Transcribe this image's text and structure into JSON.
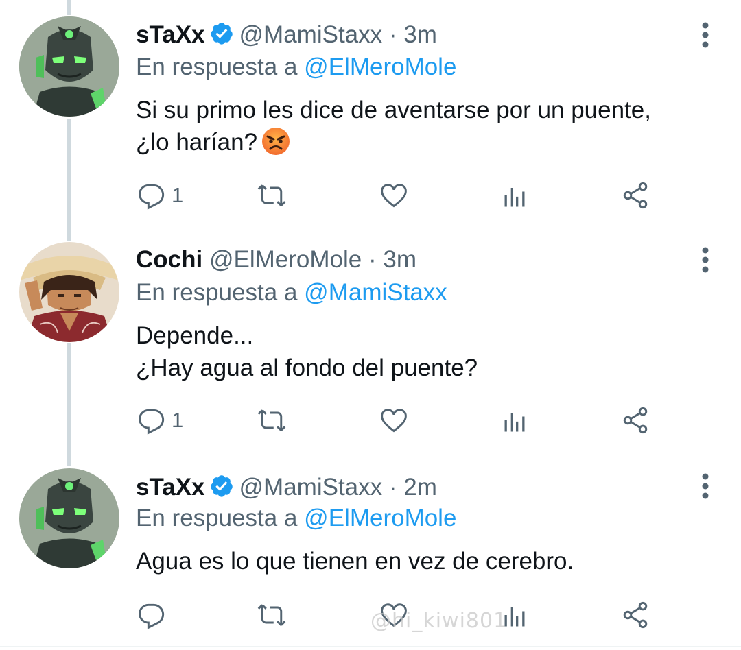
{
  "tweets": [
    {
      "name": "sTaXx",
      "handle": "@MamiStaxx",
      "dot": "·",
      "time": "3m",
      "reply_prefix": "En respuesta a",
      "reply_to": "@ElMeroMole",
      "lines": [
        "Si su primo les dice de aventarse por un puente,",
        "¿lo harían?"
      ],
      "reply_count": "1",
      "verified": true,
      "emoji": "angry-face-emoji"
    },
    {
      "name": "Cochi",
      "handle": "@ElMeroMole",
      "dot": "·",
      "time": "3m",
      "reply_prefix": "En respuesta a",
      "reply_to": "@MamiStaxx",
      "lines": [
        "Depende...",
        "¿Hay agua al fondo del puente?"
      ],
      "reply_count": "1",
      "verified": false
    },
    {
      "name": "sTaXx",
      "handle": "@MamiStaxx",
      "dot": "·",
      "time": "2m",
      "reply_prefix": "En respuesta a",
      "reply_to": "@ElMeroMole",
      "lines": [
        "Agua es lo que tienen en vez de cerebro."
      ],
      "reply_count": "",
      "verified": true
    }
  ],
  "watermark": "@hi_kiwi801",
  "colors": {
    "accent": "#1d9bf0",
    "muted": "#536471",
    "text": "#0f1419"
  }
}
